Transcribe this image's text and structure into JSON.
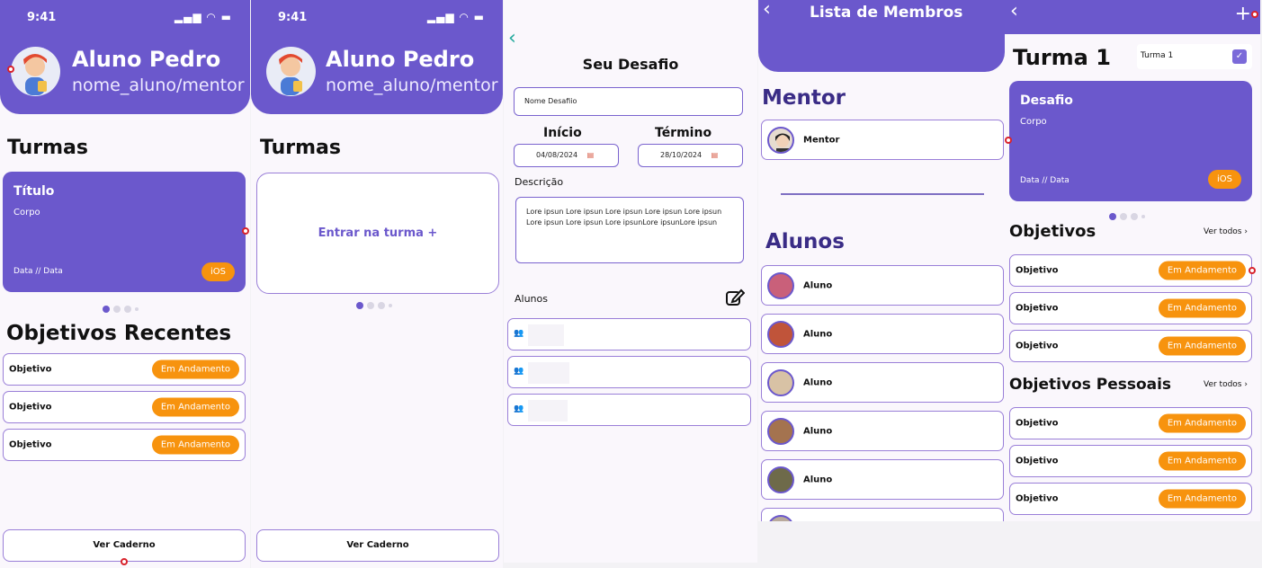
{
  "status_bar": {
    "time": "9:41",
    "icons": "▂▄▆ ◠ ▬"
  },
  "profile": {
    "name": "Aluno Pedro",
    "handle": "nome_aluno/mentor"
  },
  "turmas": {
    "heading": "Turmas",
    "card": {
      "title": "Título",
      "body": "Corpo",
      "date": "Data // Data",
      "tag": "iOS"
    },
    "join": "Entrar na turma +"
  },
  "objetivos_recentes": {
    "heading": "Objetivos Recentes",
    "items": [
      {
        "label": "Objetivo",
        "status": "Em Andamento"
      },
      {
        "label": "Objetivo",
        "status": "Em Andamento"
      },
      {
        "label": "Objetivo",
        "status": "Em Andamento"
      }
    ]
  },
  "ver_caderno": "Ver Caderno",
  "desafio": {
    "title": "Seu Desafio",
    "name_value": "Nome Desafiio",
    "start_label": "Início",
    "end_label": "Término",
    "start_date": "04/08/2024",
    "end_date": "28/10/2024",
    "desc_label": "Descrição",
    "desc_text": "Lore ipsun Lore ipsun Lore ipsun Lore ipsun Lore ipsun Lore ipsun Lore ipsun Lore ipsunLore ipsunLore ipsun",
    "alunos_label": "Alunos"
  },
  "membros": {
    "title": "Lista de Membros",
    "mentor_heading": "Mentor",
    "mentor_name": "Mentor",
    "alunos_heading": "Alunos",
    "alunos": [
      "Aluno",
      "Aluno",
      "Aluno",
      "Aluno",
      "Aluno"
    ]
  },
  "turma1": {
    "title": "Turma 1",
    "select_value": "Turma 1",
    "card": {
      "title": "Desafio",
      "body": "Corpo",
      "date": "Data // Data",
      "tag": "iOS"
    },
    "objetivos_heading": "Objetivos",
    "pessoais_heading": "Objetivos Pessoais",
    "ver_todos": "Ver todos ›",
    "objetivos": [
      {
        "label": "Objetivo",
        "status": "Em Andamento"
      },
      {
        "label": "Objetivo",
        "status": "Em Andamento"
      },
      {
        "label": "Objetivo",
        "status": "Em Andamento"
      }
    ],
    "pessoais": [
      {
        "label": "Objetivo",
        "status": "Em Andamento"
      },
      {
        "label": "Objetivo",
        "status": "Em Andamento"
      },
      {
        "label": "Objetivo",
        "status": "Em Andamento"
      }
    ]
  },
  "colors": {
    "primary": "#6b58cc",
    "accent": "#f7930e",
    "border": "#9a7fd8",
    "background": "#faf7fc"
  },
  "icons": [
    "back-icon",
    "plus-icon",
    "calendar-icon",
    "edit-icon",
    "group-icon",
    "checkbox-icon"
  ]
}
